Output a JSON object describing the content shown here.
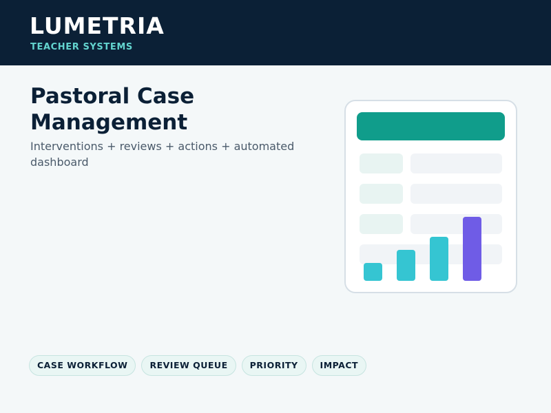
{
  "brand": {
    "name": "LUMETRIA",
    "subtitle": "TEACHER SYSTEMS"
  },
  "hero": {
    "title": "Pastoral Case Management",
    "subtitle": "Interventions + reviews + actions + automated dashboard"
  },
  "illustration": {
    "icon": "dashboard-table-chart-icon",
    "bar_levels": [
      0.28,
      0.48,
      0.69,
      1.0
    ],
    "bar_colors": [
      "#35c5d2",
      "#35c5d2",
      "#35c5d2",
      "#6f5ce6"
    ]
  },
  "tags": [
    "CASE WORKFLOW",
    "REVIEW QUEUE",
    "PRIORITY",
    "IMPACT"
  ],
  "colors": {
    "header_bg": "#0b2036",
    "accent_teal": "#109d8b",
    "accent_cyan": "#63d4cf",
    "bar_cyan": "#35c5d2",
    "bar_purple": "#6f5ce6"
  }
}
